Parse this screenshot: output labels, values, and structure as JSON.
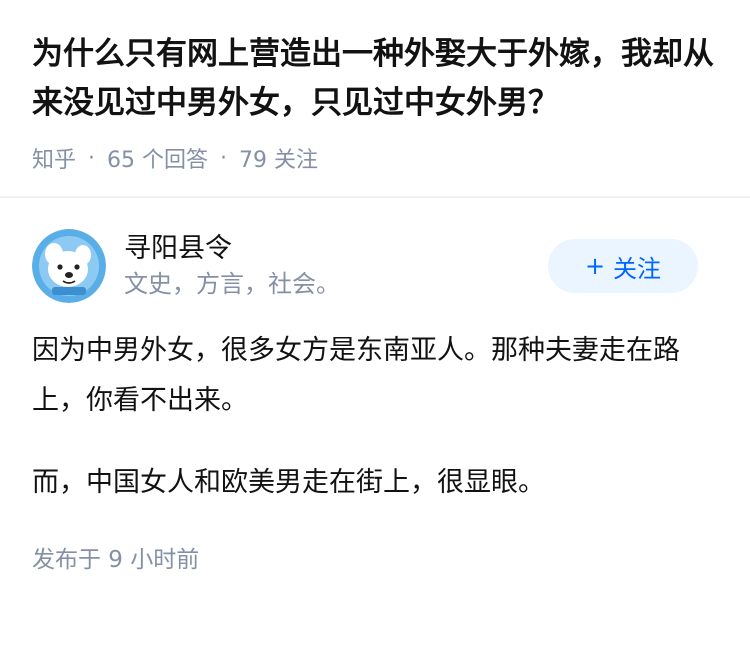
{
  "question": {
    "title": "为什么只有网上营造出一种外娶大于外嫁，我却从来没见过中男外女，只见过中女外男？",
    "source": "知乎",
    "answer_count": "65 个回答",
    "follower_count": "79 关注"
  },
  "answer": {
    "author": {
      "name": "寻阳县令",
      "bio": "文史，方言，社会。",
      "avatar_icon": "dog-avatar-icon"
    },
    "follow_button": {
      "plus": "+",
      "label": "关注"
    },
    "paragraphs": [
      "因为中男外女，很多女方是东南亚人。那种夫妻走在路上，你看不出来。",
      "而，中国女人和欧美男走在街上，很显眼。"
    ],
    "publish_time": "发布于 9 小时前"
  },
  "colors": {
    "accent": "#0066ff",
    "follow_bg": "#ebf5ff",
    "meta_gray": "#8590a6",
    "text": "#121212"
  }
}
